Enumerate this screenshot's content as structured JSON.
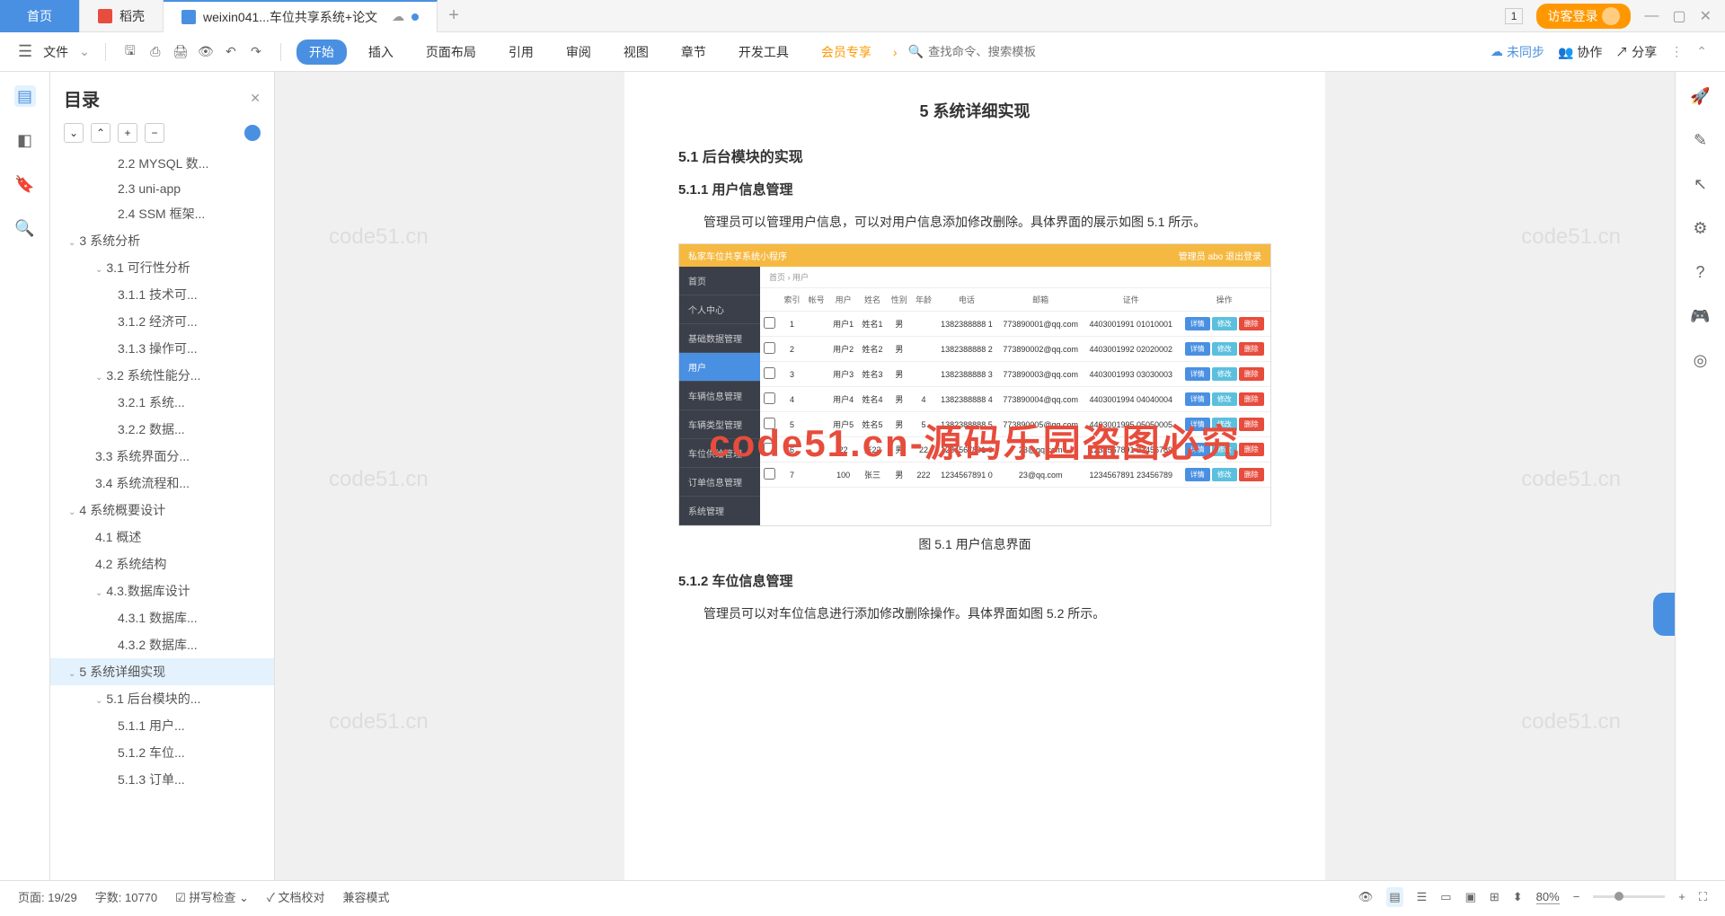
{
  "titleBar": {
    "homeTab": "首页",
    "daokeTab": "稻壳",
    "docTab": "weixin041...车位共享系统+论文",
    "pageIndicator": "1",
    "loginBtn": "访客登录"
  },
  "toolbar": {
    "fileMenu": "文件",
    "startBtn": "开始",
    "menus": [
      "插入",
      "页面布局",
      "引用",
      "审阅",
      "视图",
      "章节",
      "开发工具",
      "会员专享"
    ],
    "searchCmd": "查找命令、搜索模板",
    "unsyncBtn": "未同步",
    "collabBtn": "协作",
    "shareBtn": "分享"
  },
  "outline": {
    "title": "目录",
    "items": [
      {
        "level": 3,
        "text": "2.2 MYSQL 数..."
      },
      {
        "level": 3,
        "text": "2.3 uni-app"
      },
      {
        "level": 3,
        "text": "2.4 SSM 框架..."
      },
      {
        "level": 1,
        "text": "3 系统分析",
        "chev": "⌄"
      },
      {
        "level": 2,
        "text": "3.1 可行性分析",
        "chev": "⌄"
      },
      {
        "level": 3,
        "text": "3.1.1 技术可..."
      },
      {
        "level": 3,
        "text": "3.1.2 经济可..."
      },
      {
        "level": 3,
        "text": "3.1.3 操作可..."
      },
      {
        "level": 2,
        "text": "3.2 系统性能分...",
        "chev": "⌄"
      },
      {
        "level": 3,
        "text": "3.2.1  系统..."
      },
      {
        "level": 3,
        "text": "3.2.2  数据..."
      },
      {
        "level": 2,
        "text": "3.3 系统界面分..."
      },
      {
        "level": 2,
        "text": "3.4 系统流程和..."
      },
      {
        "level": 1,
        "text": "4 系统概要设计",
        "chev": "⌄"
      },
      {
        "level": 2,
        "text": "4.1 概述"
      },
      {
        "level": 2,
        "text": "4.2 系统结构"
      },
      {
        "level": 2,
        "text": "4.3.数据库设计",
        "chev": "⌄"
      },
      {
        "level": 3,
        "text": "4.3.1 数据库..."
      },
      {
        "level": 3,
        "text": "4.3.2 数据库..."
      },
      {
        "level": 1,
        "text": "5 系统详细实现",
        "chev": "⌄",
        "selected": true
      },
      {
        "level": 2,
        "text": "5.1 后台模块的...",
        "chev": "⌄"
      },
      {
        "level": 3,
        "text": "5.1.1  用户..."
      },
      {
        "level": 3,
        "text": "5.1.2  车位..."
      },
      {
        "level": 3,
        "text": "5.1.3  订单..."
      }
    ]
  },
  "document": {
    "chapterTitle": "5 系统详细实现",
    "h2_1": "5.1  后台模块的实现",
    "h3_1": "5.1.1  用户信息管理",
    "p1": "管理员可以管理用户信息，可以对用户信息添加修改删除。具体界面的展示如图 5.1 所示。",
    "caption1": "图 5.1  用户信息界面",
    "h3_2": "5.1.2  车位信息管理",
    "p2": "管理员可以对车位信息进行添加修改删除操作。具体界面如图 5.2 所示。",
    "redOverlay": "code51.cn-源码乐园盗图必究",
    "watermark": "code51.cn"
  },
  "screenshot": {
    "title": "私家车位共享系统小程序",
    "userLabel": "管理员 abo   退出登录",
    "crumb": "首页 › 用户",
    "side": [
      "首页",
      "个人中心",
      "基础数据管理",
      "用户",
      "车辆信息管理",
      "车辆类型管理",
      "车位供给管理",
      "订单信息管理",
      "系统管理"
    ],
    "th": [
      "",
      "索引",
      "帐号",
      "用户",
      "姓名",
      "性别",
      "年龄",
      "电话",
      "邮箱",
      "证件",
      "操作"
    ],
    "rows": [
      [
        "",
        "1",
        "",
        "用户1",
        "姓名1",
        "男",
        "",
        "1382388888 1",
        "773890001@qq.com",
        "4403001991 01010001",
        ""
      ],
      [
        "",
        "2",
        "",
        "用户2",
        "姓名2",
        "男",
        "",
        "1382388888 2",
        "773890002@qq.com",
        "4403001992 02020002",
        ""
      ],
      [
        "",
        "3",
        "",
        "用户3",
        "姓名3",
        "男",
        "",
        "1382388888 3",
        "773890003@qq.com",
        "4403001993 03030003",
        ""
      ],
      [
        "",
        "4",
        "",
        "用户4",
        "姓名4",
        "男",
        "4",
        "1382388888 4",
        "773890004@qq.com",
        "4403001994 04040004",
        ""
      ],
      [
        "",
        "5",
        "",
        "用户5",
        "姓名5",
        "男",
        "5",
        "1382388888 5",
        "773890005@qq.com",
        "4403001995 05050005",
        ""
      ],
      [
        "",
        "6",
        "",
        "22",
        "张22",
        "男",
        "22",
        "1234567891 0",
        "23@qq.com",
        "1234567891 23456789",
        ""
      ],
      [
        "",
        "7",
        "",
        "100",
        "张三",
        "男",
        "222",
        "1234567891 0",
        "23@qq.com",
        "1234567891 23456789",
        ""
      ]
    ],
    "btns": [
      "详情",
      "修改",
      "删除"
    ]
  },
  "statusBar": {
    "page": "页面: 19/29",
    "words": "字数: 10770",
    "spellCheck": "拼写检查",
    "docProof": "文档校对",
    "compatMode": "兼容模式",
    "zoom": "80%"
  }
}
